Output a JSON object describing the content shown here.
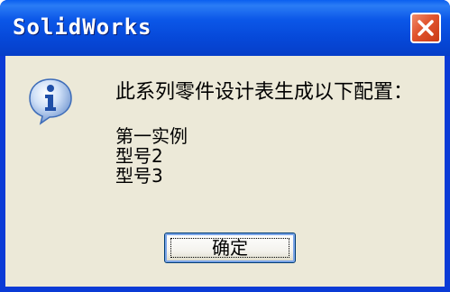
{
  "window": {
    "title": "SolidWorks"
  },
  "icons": {
    "dialog_icon": "info-icon",
    "close_icon": "close-icon"
  },
  "colors": {
    "titlebar": "#0b57e8",
    "client_bg": "#ece9d8",
    "close_button": "#e0532d"
  },
  "dialog": {
    "message": "此系列零件设计表生成以下配置：",
    "configurations": [
      "第一实例",
      "型号2",
      "型号3"
    ],
    "ok_label": "确定"
  }
}
